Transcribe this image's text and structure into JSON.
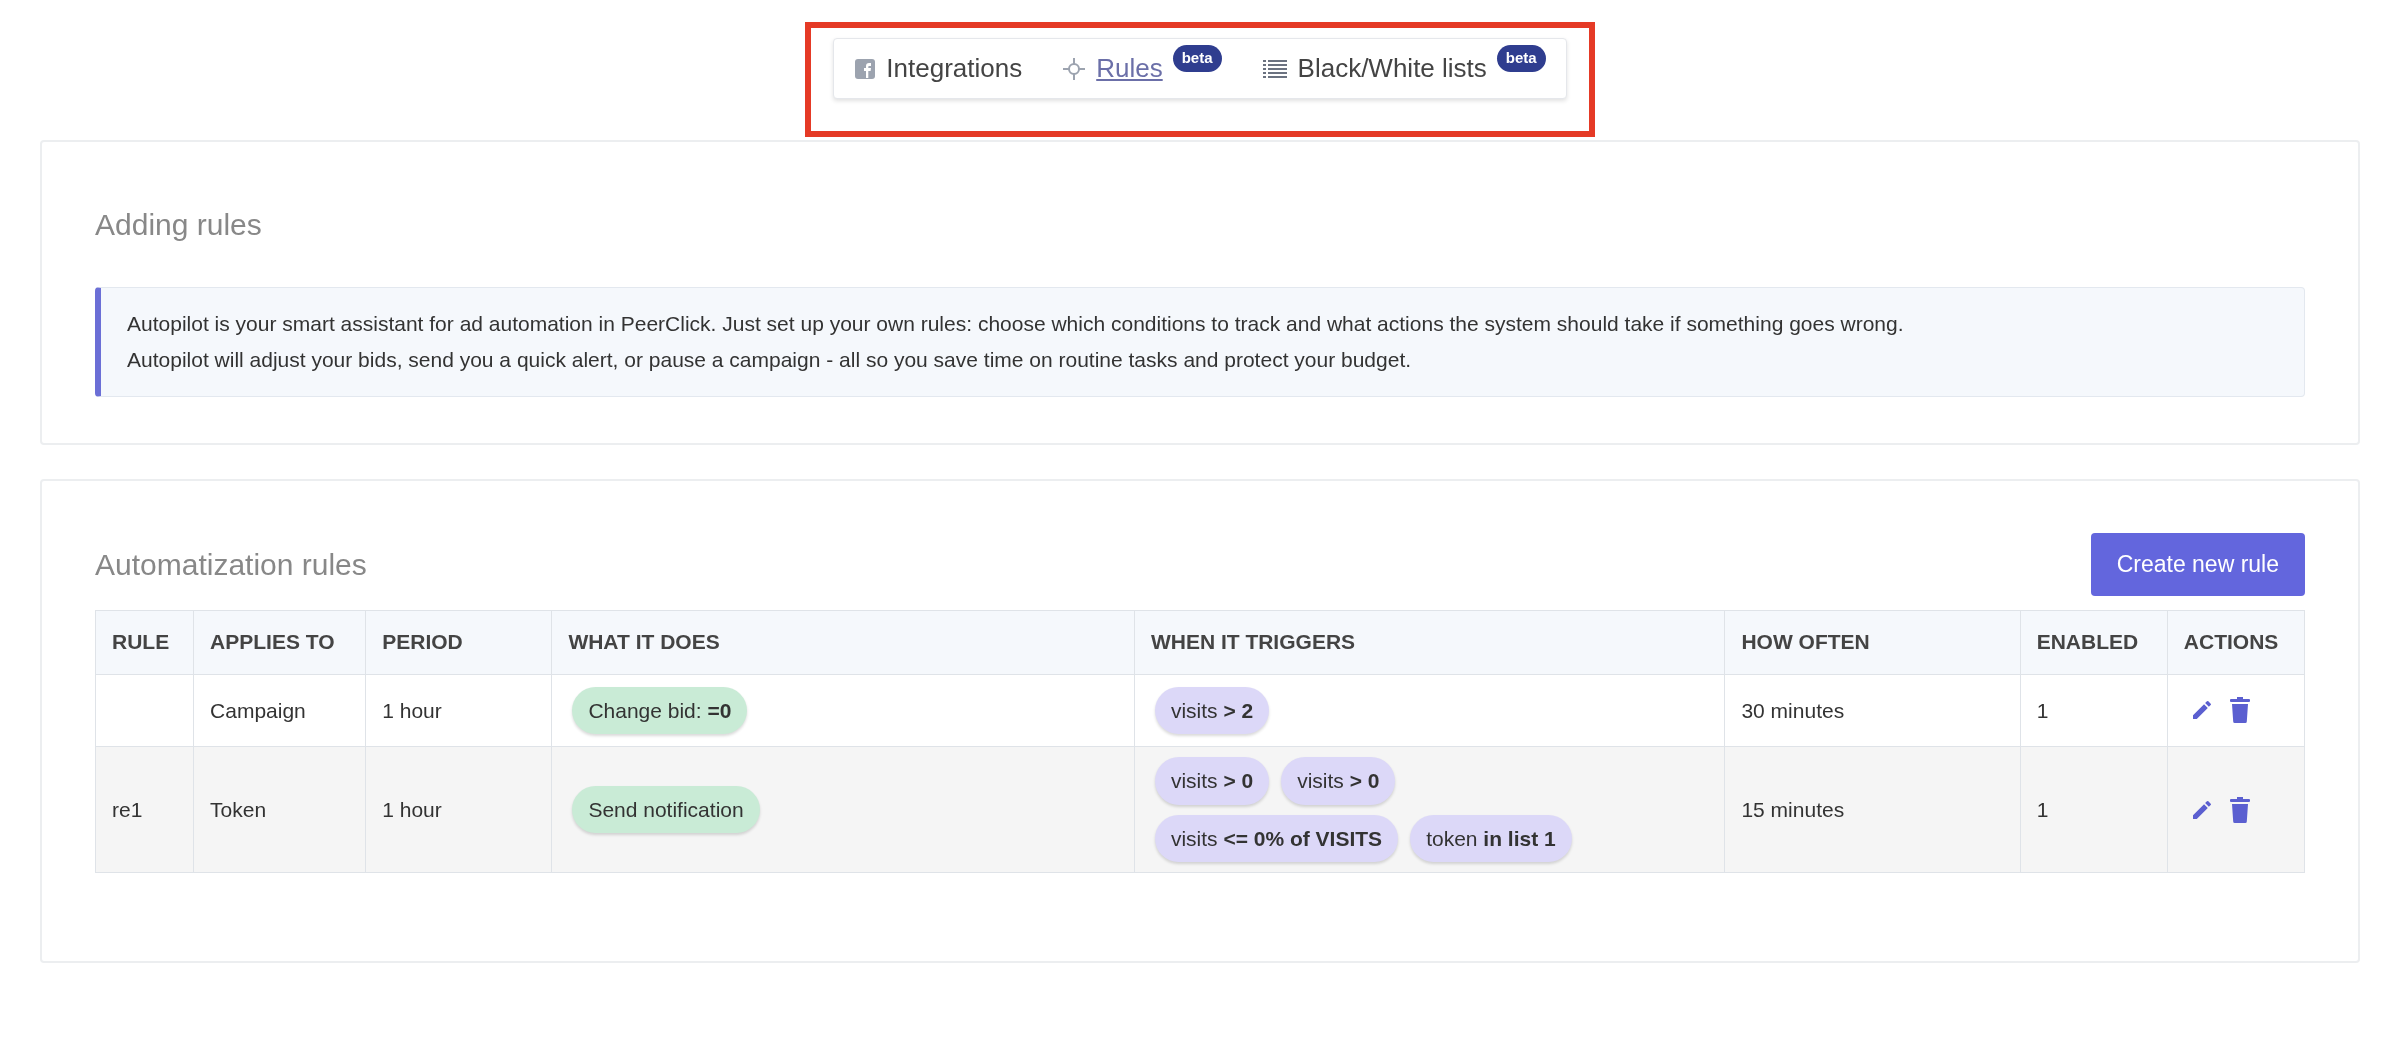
{
  "tabs": [
    {
      "label": "Integrations",
      "selected": false
    },
    {
      "label": "Rules",
      "selected": true,
      "badge": "beta"
    },
    {
      "label": "Black/White lists",
      "selected": false,
      "badge": "beta"
    }
  ],
  "intro": {
    "title": "Adding rules",
    "lines": [
      "Autopilot is your smart assistant for ad automation in PeerClick. Just set up your own rules: choose which conditions to track and what actions the system should take if something goes wrong.",
      "Autopilot will adjust your bids, send you a quick alert, or pause a campaign - all so you save time on routine tasks and protect your budget."
    ]
  },
  "rules": {
    "title": "Automatization rules",
    "create_button": "Create new rule",
    "columns": [
      "RULE",
      "APPLIES TO",
      "PERIOD",
      "WHAT IT DOES",
      "WHEN IT TRIGGERS",
      "HOW OFTEN",
      "ENABLED",
      "ACTIONS"
    ],
    "rows": [
      {
        "applies_to": "Campaign",
        "period": "1 hour",
        "actions": [
          "Change bid: **=0**"
        ],
        "triggers": [
          "visits **> 2**"
        ],
        "how_often": "30 minutes",
        "enabled": "1"
      },
      {
        "rule": "re1",
        "applies_to": "Token",
        "period": "1 hour",
        "actions": [
          "Send notification"
        ],
        "triggers": [
          "visits **> 0**",
          "visits **> 0**",
          "visits **<= 0% of VISITS**",
          "token **in list 1**"
        ],
        "how_often": "15 minutes",
        "enabled": "1"
      }
    ]
  }
}
